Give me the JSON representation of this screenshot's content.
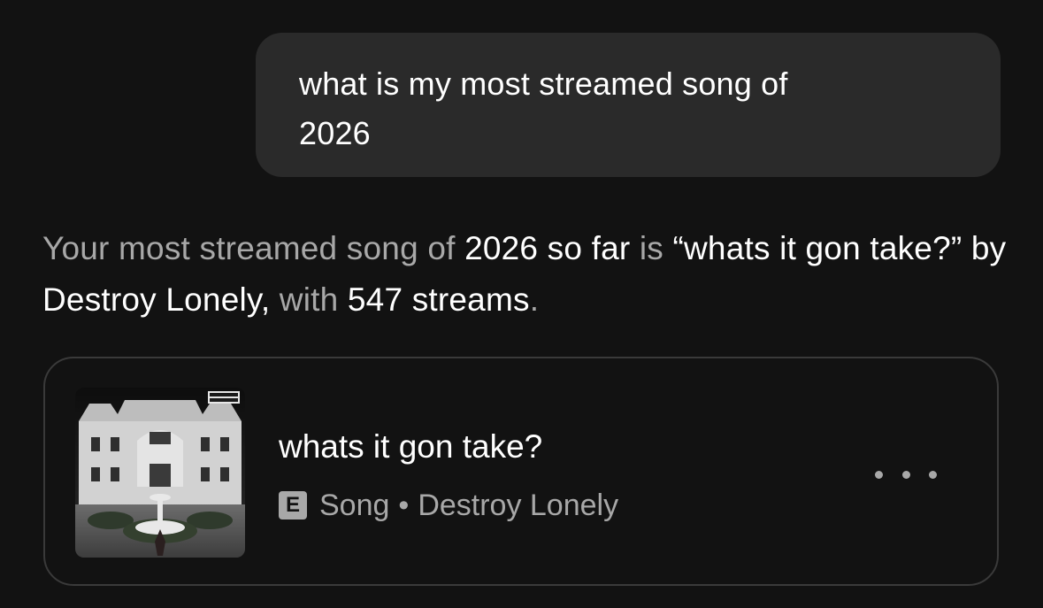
{
  "user_message": {
    "text": "what is my most streamed song of 2026"
  },
  "assistant_message": {
    "p1": "Your most streamed song of ",
    "year": "2026",
    "p2": " so far ",
    "p3": "is",
    "p4": " “whats it gon take?” by Destroy Lonely,",
    "p5": " with ",
    "count": "547 streams",
    "p6": "."
  },
  "song_card": {
    "title": "whats it gon take?",
    "explicit_badge": "E",
    "type": "Song",
    "separator": "•",
    "artist": "Destroy Lonely",
    "more_icon": "more-horizontal-icon",
    "cover_icon": "album-cover-image"
  },
  "colors": {
    "background": "#121212",
    "bubble": "#2a2a2a",
    "muted_text": "#a8a8a8",
    "card_border": "#3a3a3a"
  }
}
